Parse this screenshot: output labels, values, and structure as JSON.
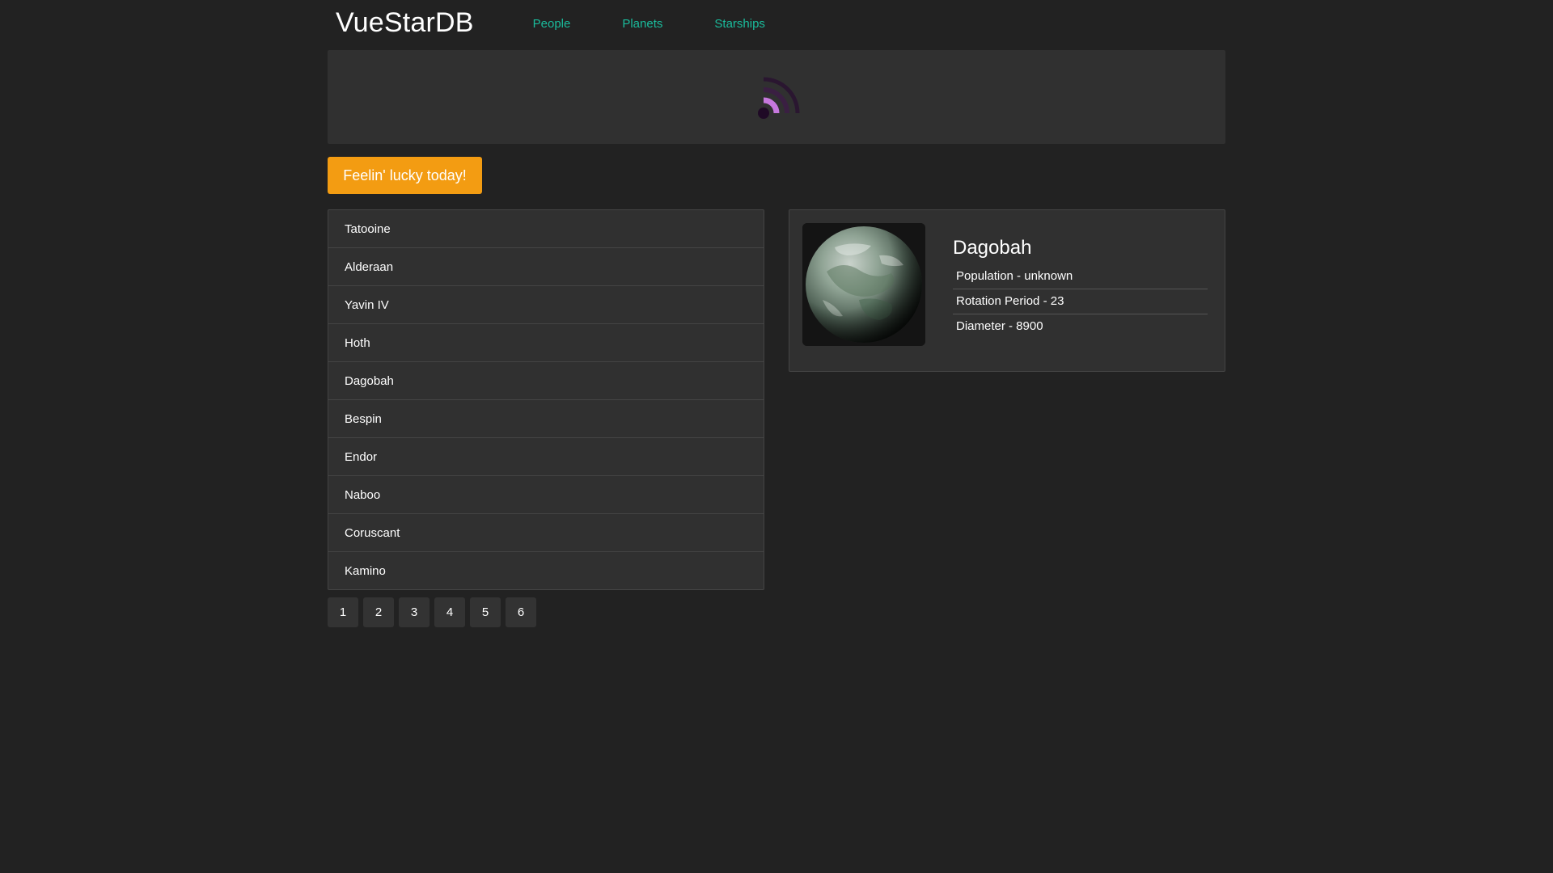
{
  "header": {
    "brand": "VueStarDB",
    "nav": [
      {
        "label": "People"
      },
      {
        "label": "Planets"
      },
      {
        "label": "Starships"
      }
    ]
  },
  "banner": {
    "state": "loading",
    "spinner_color": "#c678dd"
  },
  "lucky_button": {
    "label": "Feelin' lucky today!",
    "color": "#f39c12"
  },
  "planet_list": {
    "items": [
      {
        "name": "Tatooine"
      },
      {
        "name": "Alderaan"
      },
      {
        "name": "Yavin IV"
      },
      {
        "name": "Hoth"
      },
      {
        "name": "Dagobah"
      },
      {
        "name": "Bespin"
      },
      {
        "name": "Endor"
      },
      {
        "name": "Naboo"
      },
      {
        "name": "Coruscant"
      },
      {
        "name": "Kamino"
      }
    ]
  },
  "pagination": {
    "pages": [
      "1",
      "2",
      "3",
      "4",
      "5",
      "6"
    ]
  },
  "details": {
    "name": "Dagobah",
    "image": "planet-image",
    "properties": [
      {
        "text": "Population - unknown"
      },
      {
        "text": "Rotation Period - 23"
      },
      {
        "text": "Diameter - 8900"
      }
    ]
  },
  "colors": {
    "background": "#222222",
    "panel": "#303030",
    "link": "#1abc9c",
    "accent": "#f39c12"
  }
}
